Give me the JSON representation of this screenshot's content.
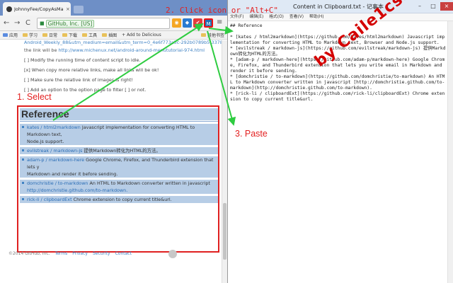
{
  "browser": {
    "tab_title": "JohnnyFee/CopyAsMar",
    "tab_close": "×",
    "nav": {
      "back": "←",
      "forward": "→",
      "reload": "C"
    },
    "secure_label": "GitHub, Inc. [US]",
    "menu_icon": "≡",
    "bookmarks": [
      {
        "label": "应用"
      },
      {
        "label": "学习"
      },
      {
        "label": "日常"
      },
      {
        "label": "下载"
      },
      {
        "label": "工具"
      },
      {
        "label": "插图"
      },
      {
        "label": "+ Add to Delicious"
      }
    ],
    "other_bookmarks": "其他书签"
  },
  "page": {
    "top_line_1": "Android_Weekly_88&utm_medium=email&utm_term=0_4e6f773a5c-292b0789b5-3378",
    "top_line_2_prefix": "the link will be ",
    "top_line_2_link": "http://www.michenux.net/android-around-menututorial-974.html",
    "tasks": [
      "[ ] Modify the running time of content script to idle.",
      "[x] When copy more relative links, make all links will be ok!",
      "[ ] Make sure the relative link of images is right!",
      "[ ] Add an option to the option page to filter [ ] or not."
    ],
    "reference_heading": "Reference",
    "references": [
      {
        "link": "kates / html2markdown",
        "desc": " Javascript implementation for converting HTML to Markdown text,",
        "cont": "Node.js support."
      },
      {
        "link": "evilstreak / markdown-js",
        "desc": " 提供Markdown转化为HTML的方法。",
        "cont": ""
      },
      {
        "link": "adam-p / markdown-here",
        "desc": " Google Chrome, Firefox, and Thunderbird extension that lets y",
        "cont": "Markdown and render it before sending."
      },
      {
        "link": "domchristie / to-markdown",
        "desc": " An HTML to Markdown converter written in javascript",
        "cont": "http://domchristie.github.com/to-markdown."
      },
      {
        "link": "rick-li / clipboardExt",
        "desc": " Chrome extension to copy current title&url.",
        "cont": ""
      }
    ],
    "footer_copyright": "©2014 GitHub, Inc.",
    "footer_links": [
      "Terms",
      "Privacy",
      "Security",
      "Contact"
    ]
  },
  "notepad": {
    "title": "Content in Clipboard.txt - 记事本",
    "menus": [
      "文件(F)",
      "编辑(E)",
      "格式(O)",
      "查看(V)",
      "帮助(H)"
    ],
    "content": "## Reference\n\n* [kates / html2markdown](https://github.com/kates/html2markdown) Javascript implementation for converting HTML to Markdown text, Browser and Node.js support.\n* [evilstreak / markdown-js](https://github.com/evilstreak/markdown-js) 提供Markdown转化为HTML的方法。\n* [adam-p / markdown-here](https://github.com/adam-p/markdown-here) Google Chrome, Firefox, and Thunderbird extension that lets you write email in Markdown and render it before sending.\n* [domchristie / to-markdown](https://github.com/domchristie/to-markdown) An HTML to Markdown converter written in javascript [http://domchristie.github.com/to-markdown](http://domchristie.github.com/to-markdown).\n* [rick-li / clipboardExt](https://github.com/rick-li/clipboardExt) Chrome extension to copy current title&url."
  },
  "annotations": {
    "step1": "1. Select",
    "step2": "2. Click icon or \"Alt+C\"",
    "step3": "3. Paste",
    "watermark": "by Caile1cs566",
    "color": "#e32020"
  }
}
